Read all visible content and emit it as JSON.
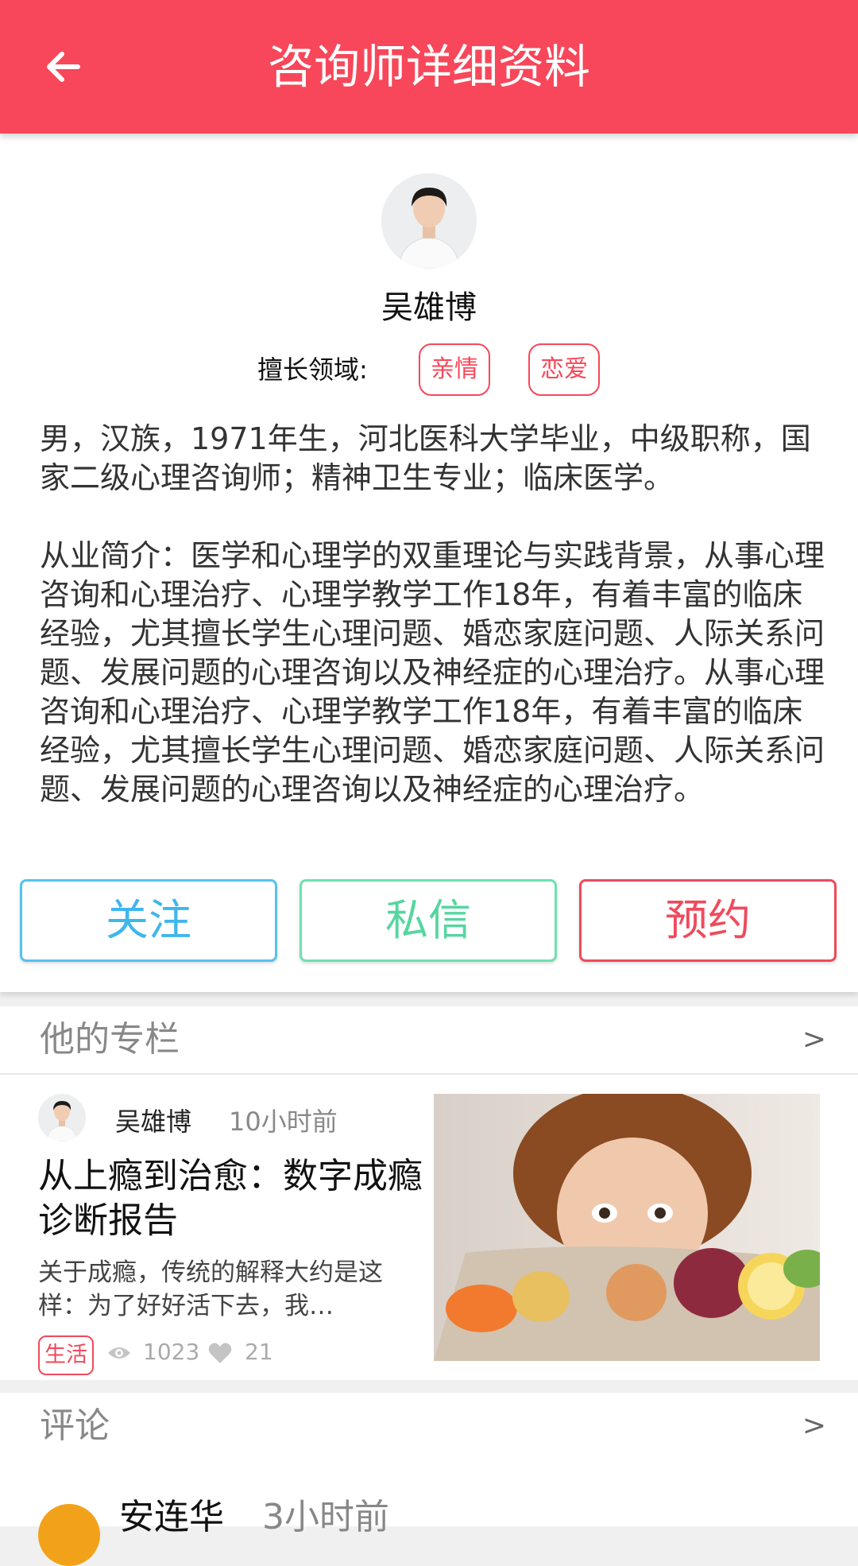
{
  "header": {
    "title": "咨询师详细资料",
    "back_icon": "arrow-left-icon",
    "color": "#f8475a"
  },
  "counselor": {
    "name": "吴雄博",
    "specialty_label": "擅长领域:",
    "tags": [
      "亲情",
      "恋爱"
    ],
    "bio_basic": "男，汉族，1971年生，河北医科大学毕业，中级职称，国家二级心理咨询师；精神卫生专业；临床医学。",
    "bio_intro": "从业简介：医学和心理学的双重理论与实践背景，从事心理咨询和心理治疗、心理学教学工作18年，有着丰富的临床经验，尤其擅长学生心理问题、婚恋家庭问题、人际关系问题、发展问题的心理咨询以及神经症的心理治疗。从事心理咨询和心理治疗、心理学教学工作18年，有着丰富的临床经验，尤其擅长学生心理问题、婚恋家庭问题、人际关系问题、发展问题的心理咨询以及神经症的心理治疗。"
  },
  "actions": {
    "follow": "关注",
    "message": "私信",
    "book": "预约"
  },
  "column_section": {
    "title": "他的专栏",
    "arrow": ">"
  },
  "article": {
    "author": "吴雄博",
    "time": "10小时前",
    "title": "从上瘾到治愈：数字成瘾诊断报告",
    "summary": "关于成瘾，传统的解释大约是这样：为了好好活下去，我…",
    "tag": "生活",
    "views": "1023",
    "likes": "21"
  },
  "comments_section": {
    "title": "评论",
    "arrow": ">"
  },
  "comment": {
    "author": "安连华",
    "time": "3小时前"
  }
}
